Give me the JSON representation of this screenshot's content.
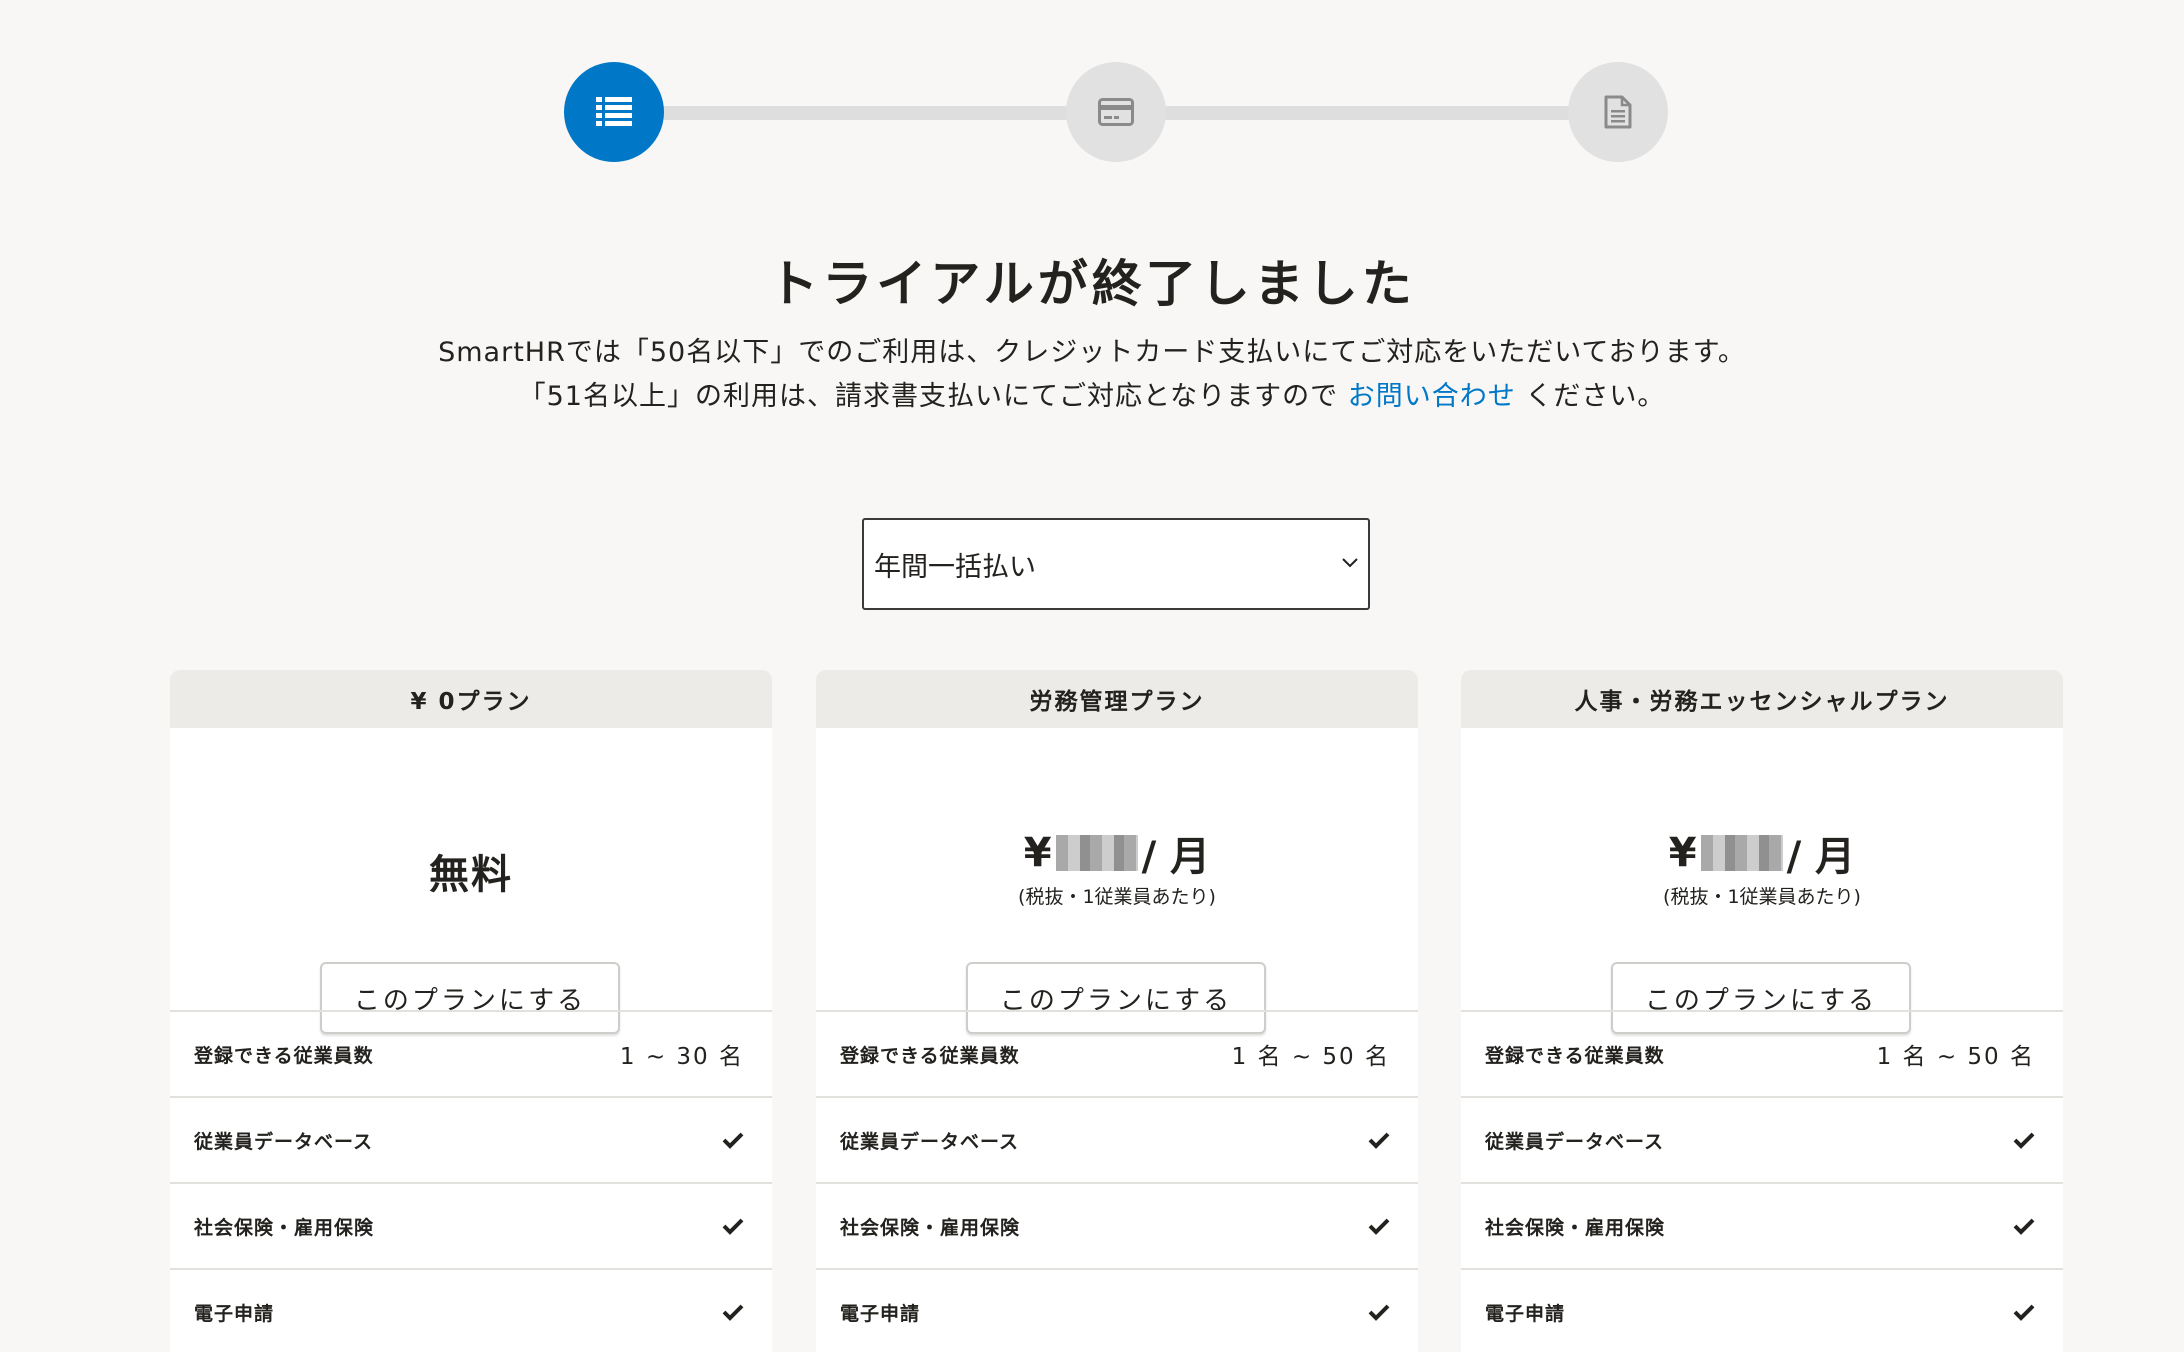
{
  "stepper": {
    "steps": [
      {
        "icon": "list-icon",
        "active": true
      },
      {
        "icon": "credit-card-icon",
        "active": false
      },
      {
        "icon": "document-icon",
        "active": false
      }
    ],
    "colors": {
      "active": "#0077c7",
      "inactive": "#e1e1e1"
    }
  },
  "header": {
    "title": "トライアルが終了しました",
    "line1": "SmartHRでは「50名以下」でのご利用は、クレジットカード支払いにてご対応をいただいております。",
    "line2_before": "「51名以上」の利用は、請求書支払いにてご対応となりますので",
    "line2_link": "お問い合わせ",
    "line2_after": "ください。"
  },
  "billing_select": {
    "value": "年間一括払い"
  },
  "plans": [
    {
      "name": "¥ 0プラン",
      "price_text": "無料",
      "button": "このプランにする",
      "rows": [
        {
          "label": "登録できる従業員数",
          "value": "1 ~ 30 名"
        },
        {
          "label": "従業員データベース",
          "value": "check"
        },
        {
          "label": "社会保険・雇用保険",
          "value": "check"
        },
        {
          "label": "電子申請",
          "value": "check"
        }
      ]
    },
    {
      "name": "労務管理プラン",
      "price_prefix": "¥",
      "price_suffix": "/ 月",
      "price_note": "(税抜・1従業員あたり)",
      "button": "このプランにする",
      "rows": [
        {
          "label": "登録できる従業員数",
          "value": "1 名 ~ 50 名"
        },
        {
          "label": "従業員データベース",
          "value": "check"
        },
        {
          "label": "社会保険・雇用保険",
          "value": "check"
        },
        {
          "label": "電子申請",
          "value": "check"
        }
      ]
    },
    {
      "name": "人事・労務エッセンシャルプラン",
      "price_prefix": "¥",
      "price_suffix": "/ 月",
      "price_note": "(税抜・1従業員あたり)",
      "button": "このプランにする",
      "rows": [
        {
          "label": "登録できる従業員数",
          "value": "1 名 ~ 50 名"
        },
        {
          "label": "従業員データベース",
          "value": "check"
        },
        {
          "label": "社会保険・雇用保険",
          "value": "check"
        },
        {
          "label": "電子申請",
          "value": "check"
        }
      ]
    }
  ]
}
